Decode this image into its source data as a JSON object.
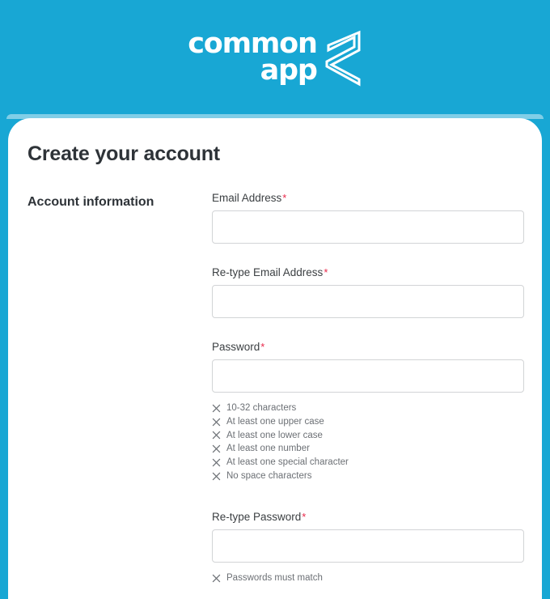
{
  "brand": {
    "logo_word_1": "common",
    "logo_word_2": "app",
    "logo_mark_name": "common-app-ribbon-logo",
    "background_color": "#18a7d4",
    "required_marker_color": "#e8284a"
  },
  "page": {
    "title": "Create your account"
  },
  "section": {
    "label": "Account information"
  },
  "fields": {
    "email": {
      "label": "Email Address",
      "required_marker": "*",
      "value": "",
      "placeholder": ""
    },
    "email_confirm": {
      "label": "Re-type Email Address",
      "required_marker": "*",
      "value": "",
      "placeholder": ""
    },
    "password": {
      "label": "Password",
      "required_marker": "*",
      "value": "",
      "placeholder": ""
    },
    "password_confirm": {
      "label": "Re-type Password",
      "required_marker": "*",
      "value": "",
      "placeholder": ""
    }
  },
  "password_rules": [
    {
      "text": "10-32 characters",
      "icon": "x-icon",
      "met": false
    },
    {
      "text": "At least one upper case",
      "icon": "x-icon",
      "met": false
    },
    {
      "text": "At least one lower case",
      "icon": "x-icon",
      "met": false
    },
    {
      "text": "At least one number",
      "icon": "x-icon",
      "met": false
    },
    {
      "text": "At least one special character",
      "icon": "x-icon",
      "met": false
    },
    {
      "text": "No space characters",
      "icon": "x-icon",
      "met": false
    }
  ],
  "password_match_rules": [
    {
      "text": "Passwords must match",
      "icon": "x-icon",
      "met": false
    }
  ]
}
